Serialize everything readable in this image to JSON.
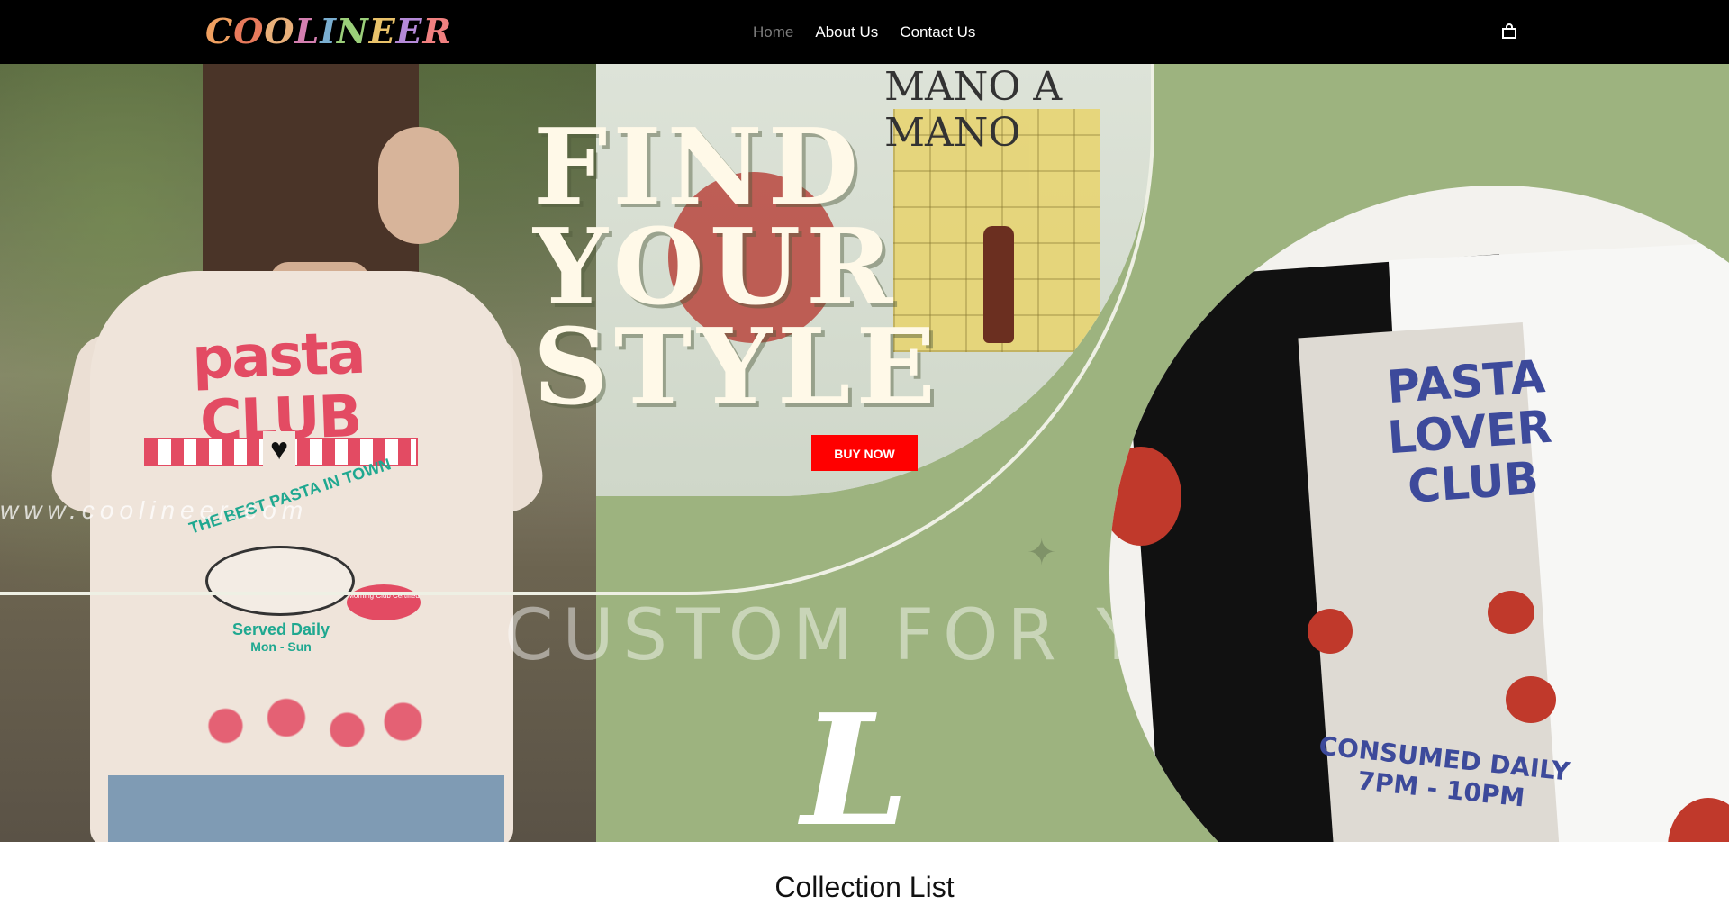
{
  "brand": {
    "logo_text": "COOLINEER",
    "logo_letters": [
      "C",
      "O",
      "O",
      "L",
      "I",
      "N",
      "E",
      "E",
      "R"
    ],
    "logo_colors": [
      "#f0a060",
      "#e87a5c",
      "#e9b07a",
      "#d47fb0",
      "#7aaed0",
      "#9bcf7a",
      "#e9c26a",
      "#b58ad8",
      "#f08080"
    ]
  },
  "nav": {
    "items": [
      {
        "label": "Home",
        "active": true
      },
      {
        "label": "About Us",
        "active": false
      },
      {
        "label": "Contact Us",
        "active": false
      }
    ],
    "cart_icon": "shopping-bag-icon"
  },
  "hero": {
    "headline": [
      "FIND",
      "YOUR",
      "STYLE"
    ],
    "cta_label": "BUY NOW",
    "cta_color": "#ff0000",
    "url_text": "www.coolineer.com",
    "tagline": "CUSTOM FOR YOU!",
    "monogram": "L",
    "shirt_left": {
      "title": "pasta CLUB",
      "arc_text": "THE BEST PASTA IN TOWN",
      "served": "Served Daily",
      "days": "Mon - Sun",
      "badge": "Morning Club Certified"
    },
    "shirt_top": {
      "title": "MANO A MANO"
    },
    "shirt_right": {
      "title_line1": "PASTA LOVER",
      "title_line2": "CLUB",
      "footer_line1": "CONSUMED DAILY",
      "footer_line2": "7PM - 10PM"
    },
    "background_color": "#9db37f"
  },
  "section": {
    "title": "Collection List"
  }
}
